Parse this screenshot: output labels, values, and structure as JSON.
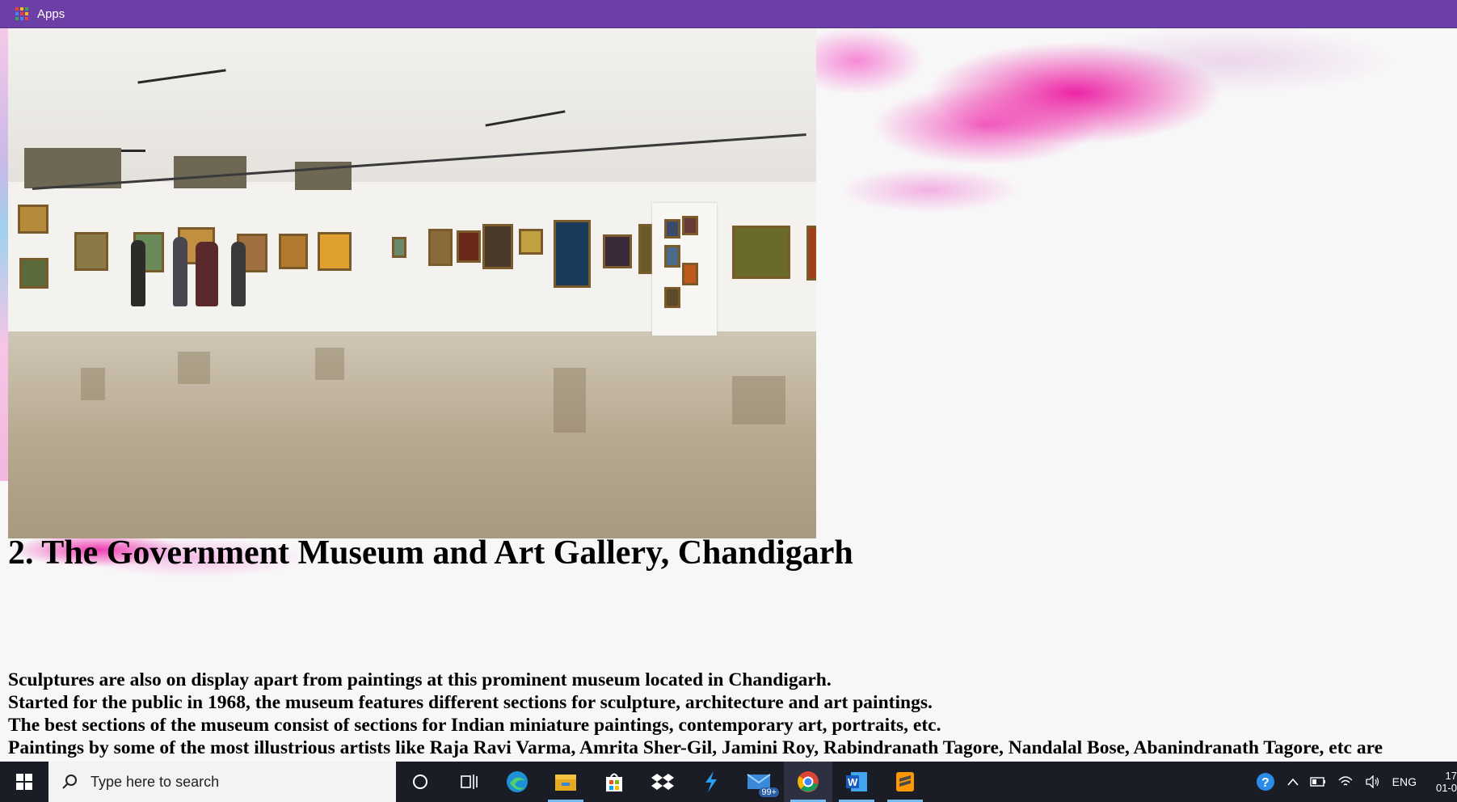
{
  "bookmarks": {
    "apps_label": "Apps"
  },
  "article": {
    "heading": "2. The Government Museum and Art Gallery, Chandigarh",
    "lines": [
      "Sculptures are also on display apart from paintings at this prominent museum located in Chandigarh.",
      "Started for the public in 1968, the museum features different sections for sculpture, architecture and art paintings.",
      "The best sections of the museum consist of sections for Indian miniature paintings, contemporary art, portraits, etc.",
      "Paintings by some of the most illustrious artists like Raja Ravi Varma, Amrita Sher-Gil, Jamini Roy, Rabindranath Tagore, Nandalal Bose, Abanindranath Tagore, etc are"
    ]
  },
  "taskbar": {
    "search_placeholder": "Type here to search",
    "mail_badge": "99+",
    "language": "ENG",
    "clock_time": "17",
    "clock_date": "01-0"
  },
  "colors": {
    "bookmarks_bar": "#6b3fa6",
    "taskbar": "#1a1d26",
    "accent_pink": "#ec18a0"
  }
}
